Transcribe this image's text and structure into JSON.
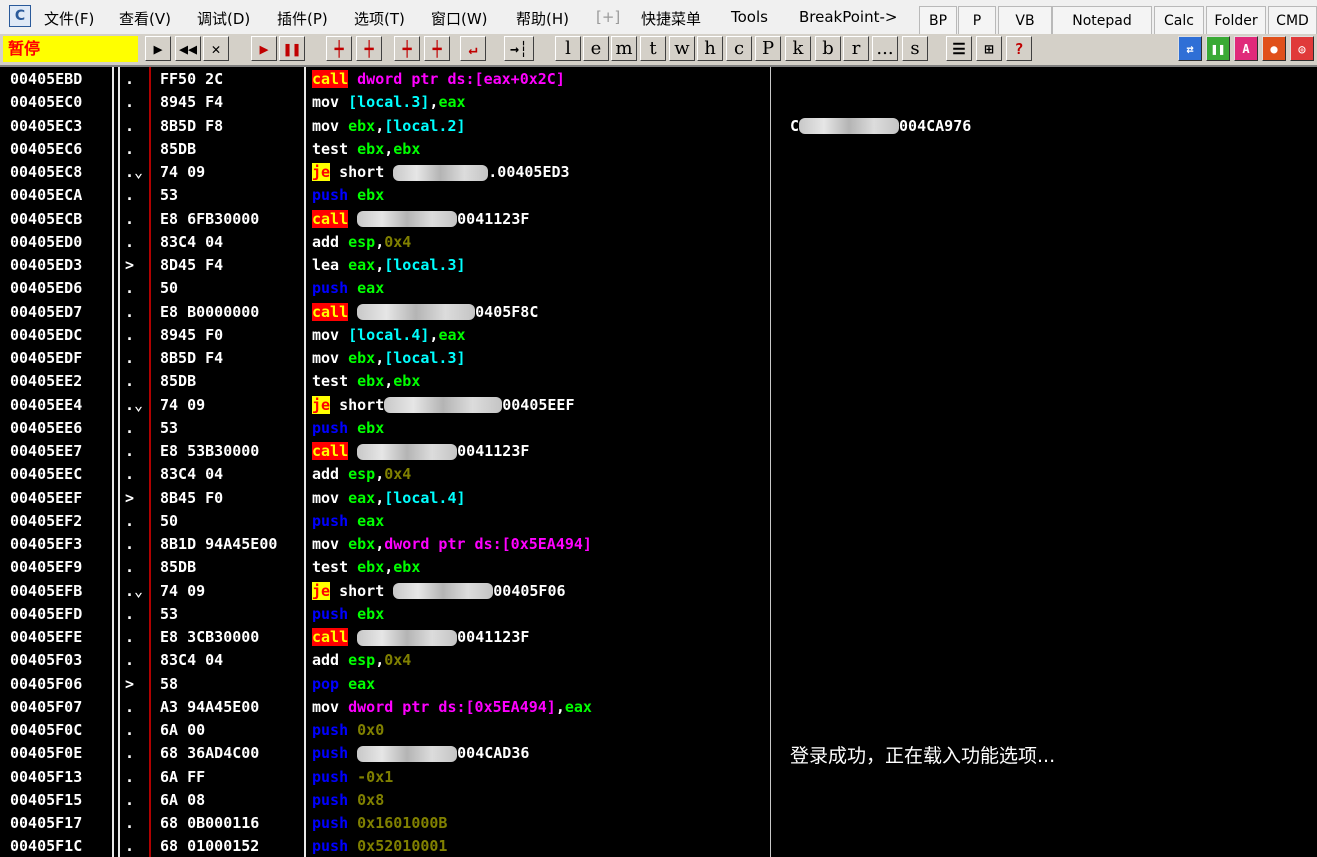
{
  "menubar": {
    "logo": "C",
    "items": [
      "文件(F)",
      "查看(V)",
      "调试(D)",
      "插件(P)",
      "选项(T)",
      "窗口(W)",
      "帮助(H)",
      "[+]",
      "快捷菜单",
      "Tools",
      "BreakPoint->"
    ],
    "buttons": [
      "BP",
      "P",
      "VB",
      "Notepad",
      "Calc",
      "Folder",
      "CMD"
    ]
  },
  "toolbar": {
    "status": "暂停",
    "buttons": [
      "▶",
      "◀◀",
      "✕",
      "▶",
      "❚❚",
      "┿",
      "┿",
      "┿",
      "┿",
      "↵",
      "→┆"
    ],
    "letters": [
      "l",
      "e",
      "m",
      "t",
      "w",
      "h",
      "c",
      "P",
      "k",
      "b",
      "r",
      "...",
      "s"
    ],
    "views": [
      "☰",
      "⊞",
      "?"
    ],
    "icon_names": [
      "open-icon",
      "rewind-icon",
      "close-icon",
      "run-icon",
      "pause-icon",
      "step-into-icon",
      "step-over-icon",
      "trace-into-icon",
      "trace-over-icon",
      "execute-till-return-icon",
      "go-to-icon"
    ],
    "right_icons": [
      "refresh-icon",
      "pause-all-icon",
      "a-icon",
      "record-icon",
      "target-icon"
    ]
  },
  "disasm": {
    "rows": [
      {
        "addr": "00405EBD",
        "mark": ".",
        "hex": "FF50 2C",
        "ins": [
          {
            "t": "call",
            "c": "k-call"
          },
          {
            "t": " "
          },
          {
            "t": "dword ptr ds:[eax+0x2C]",
            "c": "c-ptr"
          }
        ]
      },
      {
        "addr": "00405EC0",
        "mark": ".",
        "hex": "8945 F4",
        "ins": [
          {
            "t": "mov ",
            "c": "k-mov"
          },
          {
            "t": "[local.3]",
            "c": "c-mem"
          },
          {
            "t": ","
          },
          {
            "t": "eax",
            "c": "c-reg"
          }
        ]
      },
      {
        "addr": "00405EC3",
        "mark": ".",
        "hex": "8B5D F8",
        "ins": [
          {
            "t": "mov ",
            "c": "k-mov"
          },
          {
            "t": "ebx",
            "c": "c-reg"
          },
          {
            "t": ","
          },
          {
            "t": "[local.2]",
            "c": "c-mem"
          }
        ]
      },
      {
        "addr": "00405EC6",
        "mark": ".",
        "hex": "85DB",
        "ins": [
          {
            "t": "test ",
            "c": "k-test"
          },
          {
            "t": "ebx",
            "c": "c-reg"
          },
          {
            "t": ","
          },
          {
            "t": "ebx",
            "c": "c-reg"
          }
        ]
      },
      {
        "addr": "00405EC8",
        "mark": ".⌄",
        "hex": "74 09",
        "ins": [
          {
            "t": "je",
            "c": "k-je"
          },
          {
            "t": " short "
          },
          {
            "blur": 95
          },
          {
            "t": ".00405ED3"
          }
        ]
      },
      {
        "addr": "00405ECA",
        "mark": ".",
        "hex": "53",
        "ins": [
          {
            "t": "push ",
            "c": "k-push"
          },
          {
            "t": "ebx",
            "c": "c-reg"
          }
        ]
      },
      {
        "addr": "00405ECB",
        "mark": ".",
        "hex": "E8 6FB30000",
        "ins": [
          {
            "t": "call",
            "c": "k-call"
          },
          {
            "t": " "
          },
          {
            "blur": 100
          },
          {
            "t": "0041123F"
          }
        ]
      },
      {
        "addr": "00405ED0",
        "mark": ".",
        "hex": "83C4 04",
        "ins": [
          {
            "t": "add ",
            "c": "k-add"
          },
          {
            "t": "esp",
            "c": "c-reg"
          },
          {
            "t": ","
          },
          {
            "t": "0x4",
            "c": "c-num"
          }
        ]
      },
      {
        "addr": "00405ED3",
        "mark": ">",
        "hex": "8D45 F4",
        "ins": [
          {
            "t": "lea ",
            "c": "k-lea"
          },
          {
            "t": "eax",
            "c": "c-reg"
          },
          {
            "t": ","
          },
          {
            "t": "[local.3]",
            "c": "c-mem"
          }
        ]
      },
      {
        "addr": "00405ED6",
        "mark": ".",
        "hex": "50",
        "ins": [
          {
            "t": "push ",
            "c": "k-push"
          },
          {
            "t": "eax",
            "c": "c-reg"
          }
        ]
      },
      {
        "addr": "00405ED7",
        "mark": ".",
        "hex": "E8 B0000000",
        "ins": [
          {
            "t": "call",
            "c": "k-call"
          },
          {
            "t": " "
          },
          {
            "blur": 118
          },
          {
            "t": "0405F8C"
          }
        ]
      },
      {
        "addr": "00405EDC",
        "mark": ".",
        "hex": "8945 F0",
        "ins": [
          {
            "t": "mov ",
            "c": "k-mov"
          },
          {
            "t": "[local.4]",
            "c": "c-mem"
          },
          {
            "t": ","
          },
          {
            "t": "eax",
            "c": "c-reg"
          }
        ]
      },
      {
        "addr": "00405EDF",
        "mark": ".",
        "hex": "8B5D F4",
        "ins": [
          {
            "t": "mov ",
            "c": "k-mov"
          },
          {
            "t": "ebx",
            "c": "c-reg"
          },
          {
            "t": ","
          },
          {
            "t": "[local.3]",
            "c": "c-mem"
          }
        ]
      },
      {
        "addr": "00405EE2",
        "mark": ".",
        "hex": "85DB",
        "ins": [
          {
            "t": "test ",
            "c": "k-test"
          },
          {
            "t": "ebx",
            "c": "c-reg"
          },
          {
            "t": ","
          },
          {
            "t": "ebx",
            "c": "c-reg"
          }
        ]
      },
      {
        "addr": "00405EE4",
        "mark": ".⌄",
        "hex": "74 09",
        "ins": [
          {
            "t": "je",
            "c": "k-je"
          },
          {
            "t": " short"
          },
          {
            "blur": 118
          },
          {
            "t": "00405EEF"
          }
        ]
      },
      {
        "addr": "00405EE6",
        "mark": ".",
        "hex": "53",
        "ins": [
          {
            "t": "push ",
            "c": "k-push"
          },
          {
            "t": "ebx",
            "c": "c-reg"
          }
        ]
      },
      {
        "addr": "00405EE7",
        "mark": ".",
        "hex": "E8 53B30000",
        "ins": [
          {
            "t": "call",
            "c": "k-call"
          },
          {
            "t": " "
          },
          {
            "blur": 100
          },
          {
            "t": "0041123F"
          }
        ]
      },
      {
        "addr": "00405EEC",
        "mark": ".",
        "hex": "83C4 04",
        "ins": [
          {
            "t": "add ",
            "c": "k-add"
          },
          {
            "t": "esp",
            "c": "c-reg"
          },
          {
            "t": ","
          },
          {
            "t": "0x4",
            "c": "c-num"
          }
        ]
      },
      {
        "addr": "00405EEF",
        "mark": ">",
        "hex": "8B45 F0",
        "ins": [
          {
            "t": "mov ",
            "c": "k-mov"
          },
          {
            "t": "eax",
            "c": "c-reg"
          },
          {
            "t": ","
          },
          {
            "t": "[local.4]",
            "c": "c-mem"
          }
        ]
      },
      {
        "addr": "00405EF2",
        "mark": ".",
        "hex": "50",
        "ins": [
          {
            "t": "push ",
            "c": "k-push"
          },
          {
            "t": "eax",
            "c": "c-reg"
          }
        ]
      },
      {
        "addr": "00405EF3",
        "mark": ".",
        "hex": "8B1D 94A45E00",
        "ins": [
          {
            "t": "mov ",
            "c": "k-mov"
          },
          {
            "t": "ebx",
            "c": "c-reg"
          },
          {
            "t": ","
          },
          {
            "t": "dword ptr ds:[0x5EA494]",
            "c": "c-ptr"
          }
        ]
      },
      {
        "addr": "00405EF9",
        "mark": ".",
        "hex": "85DB",
        "ins": [
          {
            "t": "test ",
            "c": "k-test"
          },
          {
            "t": "ebx",
            "c": "c-reg"
          },
          {
            "t": ","
          },
          {
            "t": "ebx",
            "c": "c-reg"
          }
        ]
      },
      {
        "addr": "00405EFB",
        "mark": ".⌄",
        "hex": "74 09",
        "ins": [
          {
            "t": "je",
            "c": "k-je"
          },
          {
            "t": " short "
          },
          {
            "blur": 100
          },
          {
            "t": "00405F06"
          }
        ]
      },
      {
        "addr": "00405EFD",
        "mark": ".",
        "hex": "53",
        "ins": [
          {
            "t": "push ",
            "c": "k-push"
          },
          {
            "t": "ebx",
            "c": "c-reg"
          }
        ]
      },
      {
        "addr": "00405EFE",
        "mark": ".",
        "hex": "E8 3CB30000",
        "ins": [
          {
            "t": "call",
            "c": "k-call"
          },
          {
            "t": " "
          },
          {
            "blur": 100
          },
          {
            "t": "0041123F"
          }
        ]
      },
      {
        "addr": "00405F03",
        "mark": ".",
        "hex": "83C4 04",
        "ins": [
          {
            "t": "add ",
            "c": "k-add"
          },
          {
            "t": "esp",
            "c": "c-reg"
          },
          {
            "t": ","
          },
          {
            "t": "0x4",
            "c": "c-num"
          }
        ]
      },
      {
        "addr": "00405F06",
        "mark": ">",
        "hex": "58",
        "ins": [
          {
            "t": "pop ",
            "c": "k-pop"
          },
          {
            "t": "eax",
            "c": "c-reg"
          }
        ]
      },
      {
        "addr": "00405F07",
        "mark": ".",
        "hex": "A3 94A45E00",
        "ins": [
          {
            "t": "mov ",
            "c": "k-mov"
          },
          {
            "t": "dword ptr ds:[0x5EA494]",
            "c": "c-ptr"
          },
          {
            "t": ","
          },
          {
            "t": "eax",
            "c": "c-reg"
          }
        ]
      },
      {
        "addr": "00405F0C",
        "mark": ".",
        "hex": "6A 00",
        "ins": [
          {
            "t": "push ",
            "c": "k-push"
          },
          {
            "t": "0x0",
            "c": "c-num"
          }
        ]
      },
      {
        "addr": "00405F0E",
        "mark": ".",
        "hex": "68 36AD4C00",
        "ins": [
          {
            "t": "push ",
            "c": "k-push"
          },
          {
            "blur": 100
          },
          {
            "t": "004CAD36"
          }
        ]
      },
      {
        "addr": "00405F13",
        "mark": ".",
        "hex": "6A FF",
        "ins": [
          {
            "t": "push ",
            "c": "k-push"
          },
          {
            "t": "-0x1",
            "c": "c-num"
          }
        ]
      },
      {
        "addr": "00405F15",
        "mark": ".",
        "hex": "6A 08",
        "ins": [
          {
            "t": "push ",
            "c": "k-push"
          },
          {
            "t": "0x8",
            "c": "c-num"
          }
        ]
      },
      {
        "addr": "00405F17",
        "mark": ".",
        "hex": "68 0B000116",
        "ins": [
          {
            "t": "push ",
            "c": "k-push"
          },
          {
            "t": "0x1601000B",
            "c": "c-num"
          }
        ]
      },
      {
        "addr": "00405F1C",
        "mark": ".",
        "hex": "68 01000152",
        "ins": [
          {
            "t": "push ",
            "c": "k-push"
          },
          {
            "t": "0x52010001",
            "c": "c-num"
          }
        ]
      }
    ],
    "comments": [
      {
        "row": 2,
        "prefix": "C",
        "blur": 100,
        "text": "004CA976",
        "cn": false
      },
      {
        "row": 29,
        "text": "登录成功，正在载入功能选项...",
        "cn": true
      }
    ]
  }
}
